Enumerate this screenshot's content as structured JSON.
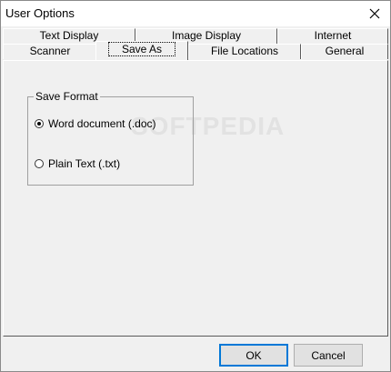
{
  "window": {
    "title": "User Options"
  },
  "tabs": {
    "row1": [
      "Text Display",
      "Image Display",
      "Internet"
    ],
    "row2": [
      "Scanner",
      "Save As",
      "File Locations",
      "General"
    ],
    "active": "Save As"
  },
  "save_format": {
    "legend": "Save Format",
    "options": [
      {
        "label": "Word document (.doc)",
        "selected": true
      },
      {
        "label": "Plain Text (.txt)",
        "selected": false
      }
    ]
  },
  "buttons": {
    "ok": "OK",
    "cancel": "Cancel"
  },
  "watermark": "SOFTPEDIA",
  "icons": {
    "close": "close-icon"
  }
}
